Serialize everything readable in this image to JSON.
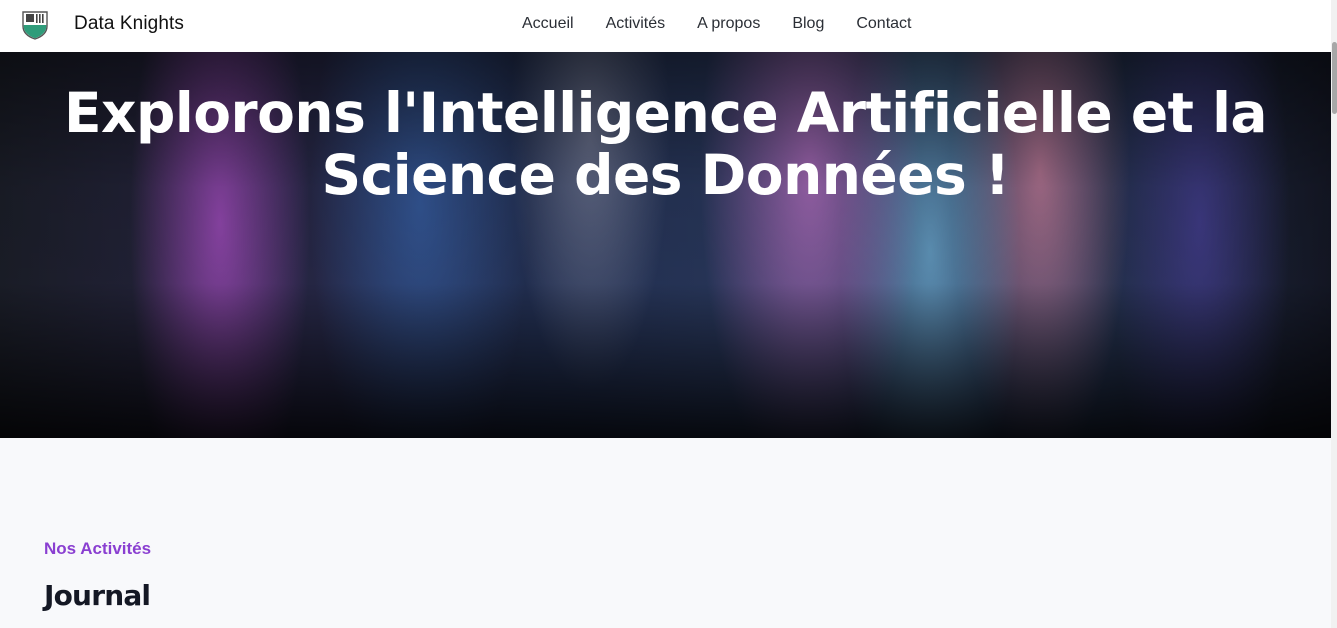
{
  "header": {
    "brand": "Data Knights",
    "logo_icon": "shield-logo-icon",
    "nav": [
      {
        "label": "Accueil"
      },
      {
        "label": "Activités"
      },
      {
        "label": "A propos"
      },
      {
        "label": "Blog"
      },
      {
        "label": "Contact"
      }
    ]
  },
  "hero": {
    "title": "Explorons l'Intelligence Artificielle et la Science des Données !"
  },
  "activities": {
    "eyebrow": "Nos Activités",
    "heading": "Journal"
  },
  "colors": {
    "accent": "#8a3fd1",
    "heading": "#141824",
    "background": "#f8f9fb",
    "logo_green": "#2f9c7a"
  }
}
